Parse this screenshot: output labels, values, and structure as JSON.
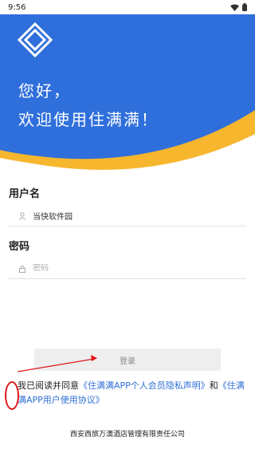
{
  "status_bar": {
    "time": "9:56"
  },
  "header": {
    "greeting_line1": "您好，",
    "greeting_line2": "欢迎使用住满满！",
    "brand_color": "#2f6fdb",
    "accent_color": "#f6b62e"
  },
  "form": {
    "username_label": "用户名",
    "username_value": "当快软件园",
    "password_label": "密码",
    "password_placeholder": "密码",
    "login_label": "登录"
  },
  "agreement": {
    "prefix": "我已阅读并同意",
    "link1": "《住满满APP个人会员隐私声明》",
    "conjunction": "和",
    "link2": "《住满满APP用户使用协议》"
  },
  "footer": {
    "company": "西安西旅万澳酒店管理有限责任公司"
  }
}
